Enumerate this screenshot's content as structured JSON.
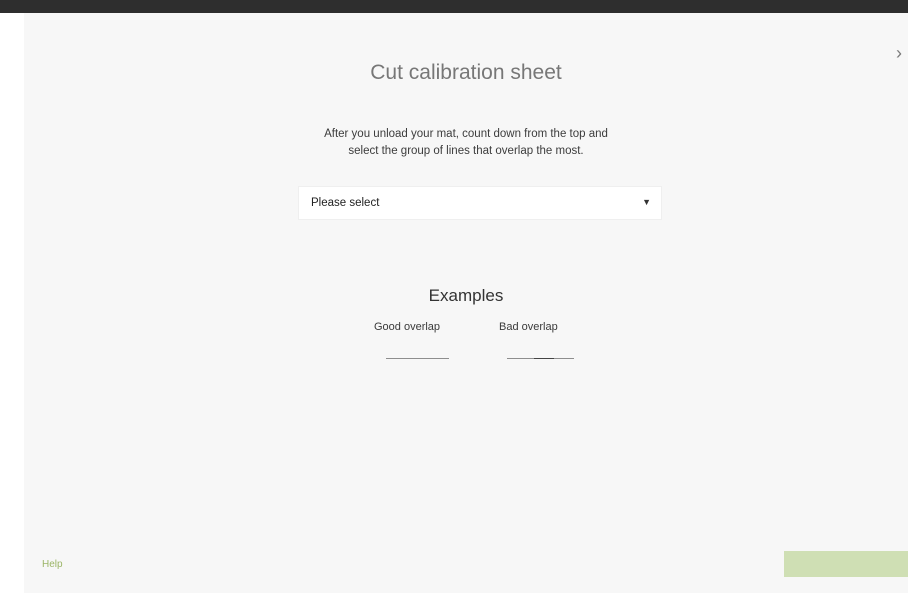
{
  "dialog": {
    "title": "Cut calibration sheet",
    "instructions_line1": "After you unload your mat, count down from the top and",
    "instructions_line2": "select the group of lines that overlap the most.",
    "select": {
      "selected_value": "Please select",
      "arrow_icon": "dropdown-arrow-icon"
    },
    "examples": {
      "title": "Examples",
      "good_label": "Good overlap",
      "bad_label": "Bad overlap"
    },
    "close_icon": "close-icon",
    "footer": {
      "help_label": "Help",
      "continue_button_color": "#cfdfb4"
    }
  },
  "colors": {
    "accent": "#9bb566",
    "topbar": "#2e2e2e",
    "background": "#f7f7f7"
  }
}
